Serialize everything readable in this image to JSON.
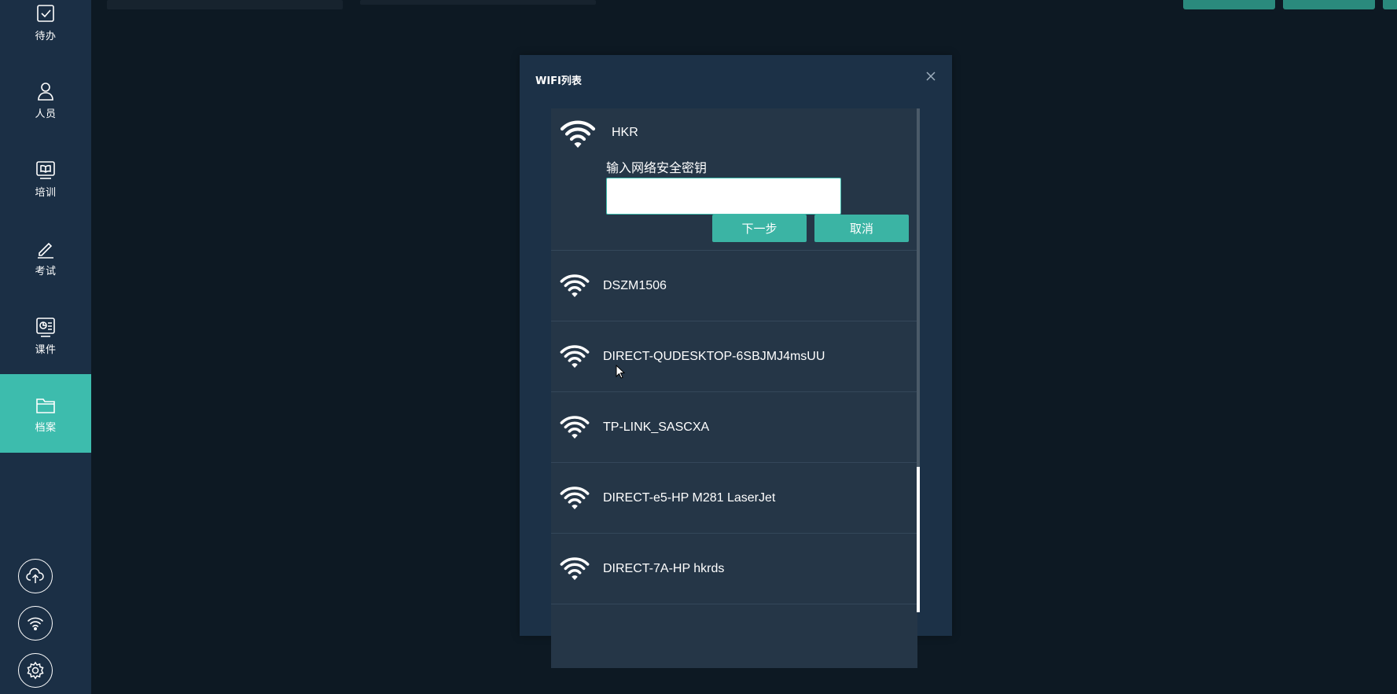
{
  "sidebar": {
    "items": [
      {
        "label": "待办",
        "icon": "todo-check-icon"
      },
      {
        "label": "人员",
        "icon": "person-icon"
      },
      {
        "label": "培训",
        "icon": "training-book-icon"
      },
      {
        "label": "考试",
        "icon": "exam-edit-icon"
      },
      {
        "label": "课件",
        "icon": "courseware-icon"
      },
      {
        "label": "档案",
        "icon": "archive-folder-icon"
      }
    ],
    "active_index": 5,
    "bottom_buttons": [
      {
        "icon": "cloud-upload-icon"
      },
      {
        "icon": "wifi-icon"
      },
      {
        "icon": "settings-gear-icon"
      }
    ]
  },
  "dialog": {
    "title": "WIFI列表",
    "close_icon": "close-icon",
    "selected_network": {
      "ssid": "HKR",
      "key_label": "输入网络安全密钥",
      "key_value": "",
      "next_label": "下一步",
      "cancel_label": "取消"
    },
    "networks": [
      {
        "ssid": "DSZM1506"
      },
      {
        "ssid": "DIRECT-QUDESKTOP-6SBJMJ4msUU"
      },
      {
        "ssid": "TP-LINK_SASCXA"
      },
      {
        "ssid": "DIRECT-e5-HP M281 LaserJet"
      },
      {
        "ssid": "DIRECT-7A-HP hkrds"
      }
    ]
  },
  "colors": {
    "accent": "#3dbcad",
    "sidebar_bg": "#1b2f45",
    "page_bg": "#0d1923",
    "dialog_bg": "#1c3147",
    "list_bg": "#253647"
  }
}
